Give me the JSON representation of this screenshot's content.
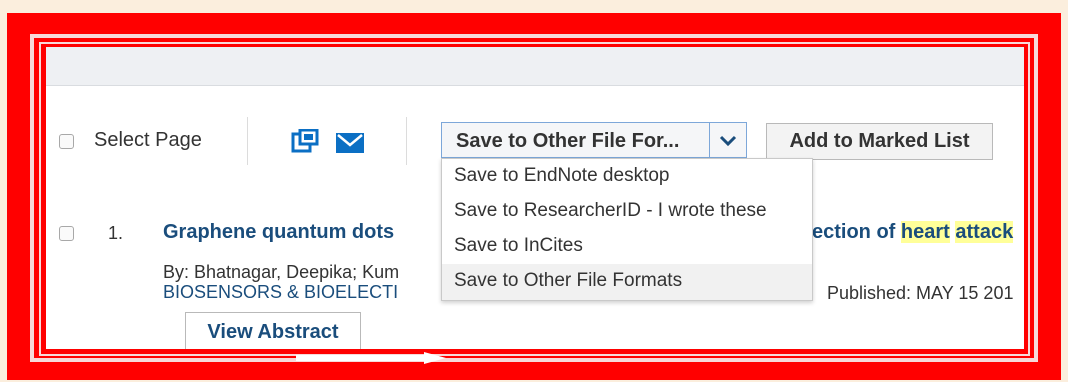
{
  "toolbar": {
    "select_page_label": "Select Page",
    "save_select_value": "Save to Other File For...",
    "add_marked_label": "Add to Marked List",
    "print_icon": "print-icon",
    "email_icon": "email-icon",
    "dropdown_icon": "chevron-down-icon"
  },
  "save_menu": {
    "items": [
      "Save to EndNote desktop",
      "Save to ResearcherID - I wrote these",
      "Save to InCites",
      "Save to Other File Formats"
    ],
    "highlighted_index": 3
  },
  "record": {
    "number": "1.",
    "title_start": "Graphene quantum dots",
    "title_end_plain": "ection of",
    "title_hl_1": "heart",
    "title_hl_2": "attack",
    "authors": "By: Bhatnagar, Deepika; Kum",
    "journal": "BIOSENSORS & BIOELECTI",
    "published": "Published: MAY 15 201",
    "view_abstract": "View Abstract"
  },
  "colors": {
    "frame": "#ff0000",
    "link": "#1a4d7c",
    "highlight": "#ffff99",
    "icon_blue": "#0b6fc4"
  }
}
